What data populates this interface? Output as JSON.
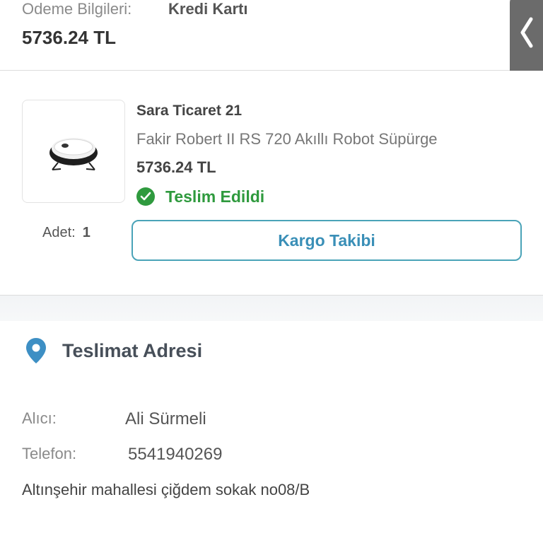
{
  "payment": {
    "label": "Odeme Bilgileri:",
    "method": "Kredi Kartı",
    "total": "5736.24 TL"
  },
  "side_tab": {
    "icon": "chevron-left-icon"
  },
  "product": {
    "image_icon": "robot-vacuum-image",
    "seller": "Sara Ticaret 21",
    "name": "Fakir Robert II RS 720 Akıllı Robot Süpürge",
    "price": "5736.24 TL",
    "status": {
      "icon": "check-circle-icon",
      "text": "Teslim Edildi",
      "color": "#2f9a3e"
    },
    "quantity_label": "Adet:",
    "quantity_value": "1",
    "cargo_button": "Kargo Takibi"
  },
  "delivery": {
    "icon": "location-pin-icon",
    "title": "Teslimat Adresi",
    "recipient_label": "Alıcı:",
    "recipient_value": "Ali Sürmeli",
    "phone_label": "Telefon:",
    "phone_value": "5541940269",
    "address": "Altınşehir mahallesi çiğdem sokak no08/B"
  },
  "colors": {
    "accent": "#3a8fb7",
    "success": "#2f9a3e",
    "pin": "#3d8fc4"
  }
}
